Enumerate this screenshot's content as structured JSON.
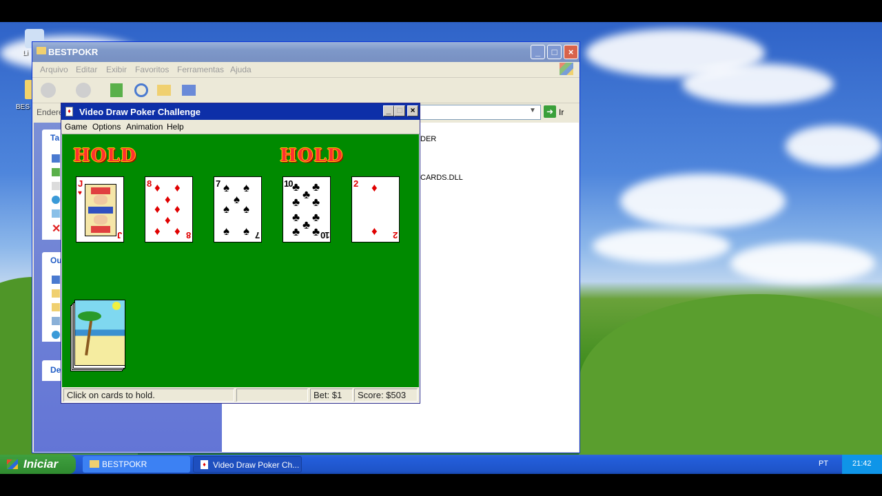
{
  "desktop": {
    "icons": [
      {
        "label": "Li"
      },
      {
        "label": "BES"
      }
    ]
  },
  "explorer": {
    "title": "BESTPOKR",
    "menu": [
      "Arquivo",
      "Editar",
      "Exibir",
      "Favoritos",
      "Ferramentas",
      "Ajuda"
    ],
    "address_label": "Endere",
    "go_label": "Ir",
    "sidebar_headers": [
      "Ta",
      "Ou",
      "De"
    ],
    "files": [
      "DER",
      "CARDS.DLL"
    ]
  },
  "poker": {
    "title": "Video Draw Poker Challenge",
    "menu": [
      "Game",
      "Options",
      "Animation",
      "Help"
    ],
    "hold_label": "HOLD",
    "cards": [
      {
        "rank": "J",
        "suit": "♥",
        "color": "#e00000",
        "held": true
      },
      {
        "rank": "8",
        "suit": "♦",
        "color": "#e00000",
        "held": false
      },
      {
        "rank": "7",
        "suit": "♠",
        "color": "#000000",
        "held": false
      },
      {
        "rank": "10",
        "suit": "♣",
        "color": "#000000",
        "held": true
      },
      {
        "rank": "2",
        "suit": "♦",
        "color": "#e00000",
        "held": false
      }
    ],
    "status": {
      "message": "Click on cards to hold.",
      "bet": "Bet: $1",
      "score": "Score: $503"
    }
  },
  "taskbar": {
    "start_label": "Iniciar",
    "tasks": [
      "BESTPOKR",
      "Video Draw Poker Ch..."
    ],
    "language": "PT",
    "clock": "21:42"
  },
  "colors": {
    "felt": "#008a00",
    "xp_blue": "#0d2fa8",
    "hold_red": "#ff3030"
  }
}
